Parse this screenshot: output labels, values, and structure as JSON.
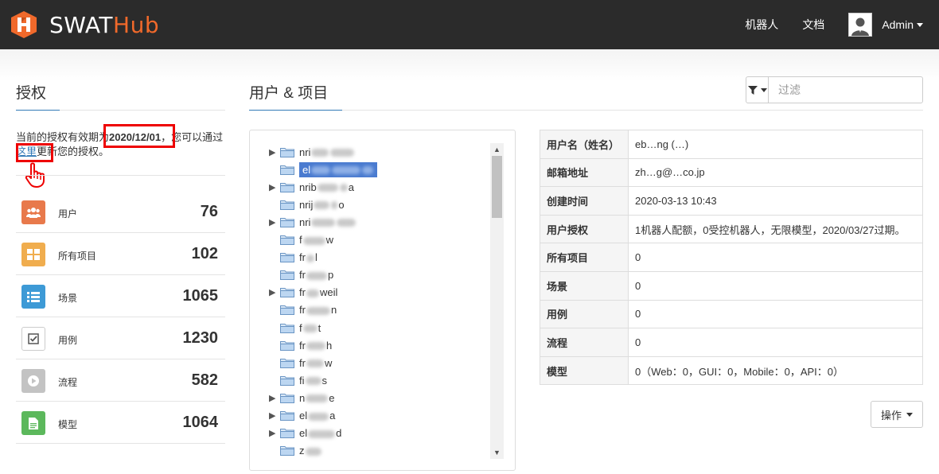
{
  "brand": {
    "name_part1": "SWAT",
    "name_part2": "Hub",
    "accent_color": "#f0692b"
  },
  "nav": {
    "robots": "机器人",
    "docs": "文档",
    "user": "Admin"
  },
  "license": {
    "title": "授权",
    "text_before": "当前的授权有效期为",
    "date": "2020/12/01",
    "text_middle": "，您可以通过",
    "link": "这里",
    "text_after": "更新您的授权。"
  },
  "stats": [
    {
      "label": "用户",
      "value": "76",
      "icon": "users-icon",
      "color": "#e8794b"
    },
    {
      "label": "所有项目",
      "value": "102",
      "icon": "grid-icon",
      "color": "#f0ad4e"
    },
    {
      "label": "场景",
      "value": "1065",
      "icon": "list-icon",
      "color": "#3d9ad6"
    },
    {
      "label": "用例",
      "value": "1230",
      "icon": "checkbox-icon",
      "color": "#ffffff"
    },
    {
      "label": "流程",
      "value": "582",
      "icon": "play-icon",
      "color": "#c3c3c3"
    },
    {
      "label": "模型",
      "value": "1064",
      "icon": "document-icon",
      "color": "#5cb85c"
    }
  ],
  "main": {
    "title": "用户 & 项目",
    "filter_placeholder": "过滤"
  },
  "tree": [
    {
      "text": "nri",
      "expandable": true,
      "selected": false
    },
    {
      "text": "el",
      "expandable": false,
      "selected": true
    },
    {
      "text": "nrib",
      "expandable": true,
      "selected": false
    },
    {
      "text": "nrij",
      "expandable": false,
      "selected": false
    },
    {
      "text": "nri",
      "expandable": true,
      "selected": false
    },
    {
      "text": "f",
      "expandable": false,
      "selected": false
    },
    {
      "text": "fr",
      "expandable": false,
      "selected": false
    },
    {
      "text": "fr",
      "expandable": false,
      "selected": false
    },
    {
      "text": "fr",
      "expandable": true,
      "selected": false
    },
    {
      "text": "fr",
      "expandable": false,
      "selected": false
    },
    {
      "text": "f",
      "expandable": false,
      "selected": false
    },
    {
      "text": "fr",
      "expandable": false,
      "selected": false
    },
    {
      "text": "fr",
      "expandable": false,
      "selected": false
    },
    {
      "text": "fi",
      "expandable": false,
      "selected": false
    },
    {
      "text": "n",
      "expandable": true,
      "selected": false
    },
    {
      "text": "el",
      "expandable": true,
      "selected": false
    },
    {
      "text": "el",
      "expandable": true,
      "selected": false
    },
    {
      "text": "z",
      "expandable": false,
      "selected": false
    }
  ],
  "tree_tails": [
    "",
    "",
    "a",
    "o",
    "",
    "w",
    "l",
    "p",
    "weil",
    "n",
    "t",
    "h",
    "w",
    "s",
    "e",
    "a",
    "d",
    ""
  ],
  "detail": [
    {
      "key": "用户名（姓名）",
      "value": "eb…ng (…)"
    },
    {
      "key": "邮箱地址",
      "value": "zh…g@…co.jp"
    },
    {
      "key": "创建时间",
      "value": "2020-03-13 10:43"
    },
    {
      "key": "用户授权",
      "value": "1机器人配额，0受控机器人，无限模型，2020/03/27过期。"
    },
    {
      "key": "所有项目",
      "value": "0"
    },
    {
      "key": "场景",
      "value": "0"
    },
    {
      "key": "用例",
      "value": "0"
    },
    {
      "key": "流程",
      "value": "0"
    },
    {
      "key": "模型",
      "value": "0（Web：0，GUI：0，Mobile：0，API：0）"
    }
  ],
  "actions": {
    "ops_label": "操作"
  }
}
